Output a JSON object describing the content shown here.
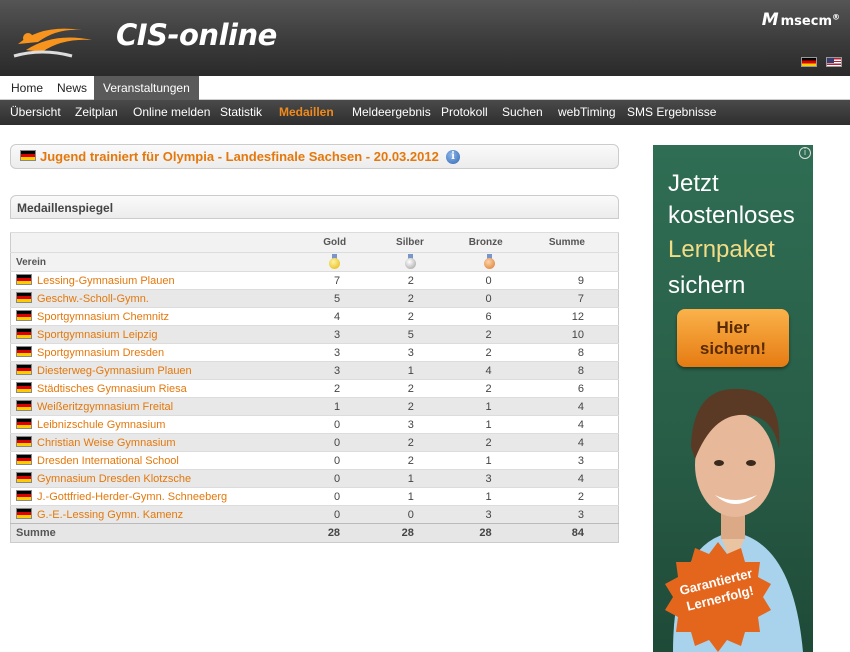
{
  "header": {
    "brand": "CIS-online",
    "partner": "msecm",
    "partner_mark": "M",
    "partner_sup": "®"
  },
  "mainnav": [
    "Home",
    "News",
    "Veranstaltungen"
  ],
  "mainnav_active": "Veranstaltungen",
  "subnav": [
    "Übersicht",
    "Zeitplan",
    "Online melden",
    "Statistik",
    "Medaillen",
    "Meldeergebnis",
    "Protokoll",
    "Suchen",
    "webTiming",
    "SMS Ergebnisse"
  ],
  "subnav_active": "Medaillen",
  "event": {
    "title": "Jugend trainiert für Olympia - Landesfinale Sachsen - 20.03.2012",
    "info_glyph": "i"
  },
  "section": {
    "title": "Medaillenspiegel"
  },
  "table": {
    "headers": {
      "verein": "Verein",
      "gold": "Gold",
      "silber": "Silber",
      "bronze": "Bronze",
      "summe": "Summe"
    },
    "rows": [
      {
        "name": "Lessing-Gymnasium Plauen",
        "gold": "7",
        "silber": "2",
        "bronze": "0",
        "summe": "9"
      },
      {
        "name": "Geschw.-Scholl-Gymn.",
        "gold": "5",
        "silber": "2",
        "bronze": "0",
        "summe": "7"
      },
      {
        "name": "Sportgymnasium Chemnitz",
        "gold": "4",
        "silber": "2",
        "bronze": "6",
        "summe": "12"
      },
      {
        "name": "Sportgymnasium Leipzig",
        "gold": "3",
        "silber": "5",
        "bronze": "2",
        "summe": "10"
      },
      {
        "name": "Sportgymnasium Dresden",
        "gold": "3",
        "silber": "3",
        "bronze": "2",
        "summe": "8"
      },
      {
        "name": "Diesterweg-Gymnasium Plauen",
        "gold": "3",
        "silber": "1",
        "bronze": "4",
        "summe": "8"
      },
      {
        "name": "Städtisches Gymnasium Riesa",
        "gold": "2",
        "silber": "2",
        "bronze": "2",
        "summe": "6"
      },
      {
        "name": "Weißeritzgymnasium Freital",
        "gold": "1",
        "silber": "2",
        "bronze": "1",
        "summe": "4"
      },
      {
        "name": "Leibnizschule Gymnasium",
        "gold": "0",
        "silber": "3",
        "bronze": "1",
        "summe": "4"
      },
      {
        "name": "Christian Weise Gymnasium",
        "gold": "0",
        "silber": "2",
        "bronze": "2",
        "summe": "4"
      },
      {
        "name": "Dresden International School",
        "gold": "0",
        "silber": "2",
        "bronze": "1",
        "summe": "3"
      },
      {
        "name": "Gymnasium Dresden Klotzsche",
        "gold": "0",
        "silber": "1",
        "bronze": "3",
        "summe": "4"
      },
      {
        "name": "J.-Gottfried-Herder-Gymn. Schneeberg",
        "gold": "0",
        "silber": "1",
        "bronze": "1",
        "summe": "2"
      },
      {
        "name": "G.-E.-Lessing Gymn. Kamenz",
        "gold": "0",
        "silber": "0",
        "bronze": "3",
        "summe": "3"
      }
    ],
    "totals": {
      "label": "Summe",
      "gold": "28",
      "silber": "28",
      "bronze": "28",
      "summe": "84"
    }
  },
  "ad": {
    "info_glyph": "i",
    "lines": [
      "Jetzt",
      "kostenloses",
      "Lernpaket",
      "sichern"
    ],
    "button_line1": "Hier",
    "button_line2": "sichern!",
    "badge_line1": "Garantierter",
    "badge_line2": "Lernerfolg!"
  },
  "colors": {
    "accent": "#e4780c",
    "subnav_active": "#f08a1c",
    "header_dark": "#3b3b3b",
    "ad_green": "#2f6e54"
  }
}
